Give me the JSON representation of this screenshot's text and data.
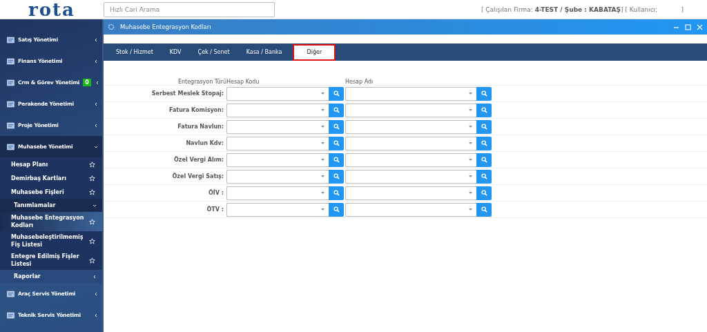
{
  "header": {
    "logo": "rota",
    "search": {
      "placeholder": "Hızlı Cari Arama"
    },
    "context": "[ Çalışılan Firma: **4-TEST / Şube : KABATAŞ**] [ Kullanıcı:            ]"
  },
  "sidebar": {
    "items": [
      {
        "label": "Satış Yönetimi",
        "expanded": false
      },
      {
        "label": "Finans Yönetimi",
        "expanded": false
      },
      {
        "label": "Crm & Görev Yönetimi",
        "expanded": false,
        "badge": "0"
      },
      {
        "label": "Perakende Yönetimi",
        "expanded": false
      },
      {
        "label": "Proje Yönetimi",
        "expanded": false
      },
      {
        "label": "Muhasebe Yönetimi",
        "expanded": true,
        "children": [
          {
            "label": "Hesap Planı",
            "selected": false
          },
          {
            "label": "Demirbaş Kartları",
            "selected": false
          },
          {
            "label": "Muhasebe Fişleri",
            "selected": false
          },
          {
            "label": "Tanımlamalar",
            "expanded": true,
            "children": [
              {
                "label": "Muhasebe Entegrasyon Kodları",
                "selected": true
              },
              {
                "label": "Muhasebeleştirilmemiş Fiş Listesi",
                "selected": false
              },
              {
                "label": "Entegre Edilmiş Fişler Listesi",
                "selected": false
              }
            ]
          },
          {
            "label": "Raporlar",
            "expanded": false
          }
        ]
      },
      {
        "label": "Araç Servis Yönetimi",
        "expanded": false
      },
      {
        "label": "Teknik Servis Yönetimi",
        "expanded": false
      }
    ]
  },
  "window": {
    "title": "Muhasebe Entegrasyon Kodları",
    "tabs": [
      {
        "label": "Stok / Hizmet",
        "selected": false
      },
      {
        "label": "KDV",
        "selected": false
      },
      {
        "label": "Çek / Senet",
        "selected": false
      },
      {
        "label": "Kasa / Banka",
        "selected": false
      },
      {
        "label": "Diğer",
        "selected": true
      }
    ],
    "columns": [
      "Entegrasyon Türü",
      "Hesap Kodu",
      "Hesap Adı"
    ],
    "rows": [
      {
        "label": "Serbest Meslek Stopaj:"
      },
      {
        "label": "Fatura Komisyon:"
      },
      {
        "label": "Fatura Navlun:"
      },
      {
        "label": "Navlun Kdv:"
      },
      {
        "label": "Özel Vergi Alım:"
      },
      {
        "label": "Özel Vergi Satış:"
      },
      {
        "label": "ÖİV :"
      },
      {
        "label": "ÖTV :"
      }
    ]
  }
}
